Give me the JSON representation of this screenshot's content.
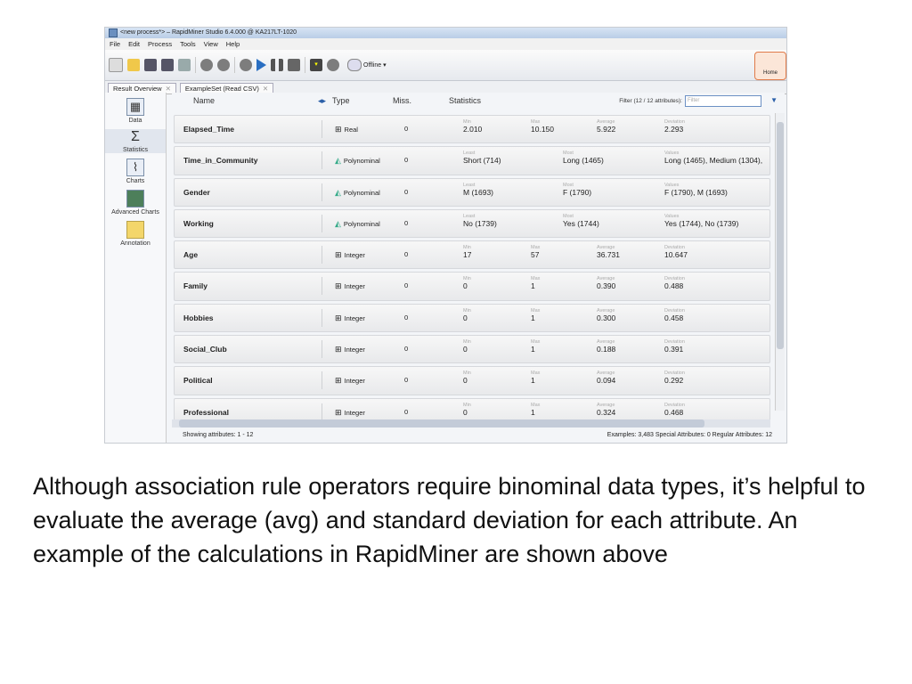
{
  "window": {
    "title": "<new process*> – RapidMiner Studio 6.4.000 @ KA217LT-1020"
  },
  "menu": [
    "File",
    "Edit",
    "Process",
    "Tools",
    "View",
    "Help"
  ],
  "toolbar": {
    "offline_label": "Offline",
    "home_label": "Home"
  },
  "tabs": [
    {
      "label": "Result Overview"
    },
    {
      "label": "ExampleSet (Read CSV)"
    }
  ],
  "left_panel": [
    "Data",
    "Statistics",
    "Charts",
    "Advanced Charts",
    "Annotation"
  ],
  "columns": {
    "name": "Name",
    "type": "Type",
    "miss": "Miss.",
    "statistics": "Statistics"
  },
  "filter": {
    "label": "Filter (12 / 12 attributes):",
    "placeholder": "Filter"
  },
  "rows": [
    {
      "name": "Elapsed_Time",
      "type": "Real",
      "miss": "0",
      "s1_label": "Min",
      "s1": "2.010",
      "s2_label": "Max",
      "s2": "10.150",
      "s3_label": "Average",
      "s3": "5.922",
      "s4_label": "Deviation",
      "s4": "2.293"
    },
    {
      "name": "Time_in_Community",
      "type": "Polynominal",
      "miss": "0",
      "s1_label": "Least",
      "s1": "Short (714)",
      "s2_label": "Most",
      "s2": "Long (1465)",
      "s3_label": "",
      "s3": "",
      "s4_label": "Values",
      "s4": "Long (1465), Medium (1304),"
    },
    {
      "name": "Gender",
      "type": "Polynominal",
      "miss": "0",
      "s1_label": "Least",
      "s1": "M (1693)",
      "s2_label": "Most",
      "s2": "F (1790)",
      "s3_label": "",
      "s3": "",
      "s4_label": "Values",
      "s4": "F (1790), M (1693)"
    },
    {
      "name": "Working",
      "type": "Polynominal",
      "miss": "0",
      "s1_label": "Least",
      "s1": "No (1739)",
      "s2_label": "Most",
      "s2": "Yes (1744)",
      "s3_label": "",
      "s3": "",
      "s4_label": "Values",
      "s4": "Yes (1744), No (1739)"
    },
    {
      "name": "Age",
      "type": "Integer",
      "miss": "0",
      "s1_label": "Min",
      "s1": "17",
      "s2_label": "Max",
      "s2": "57",
      "s3_label": "Average",
      "s3": "36.731",
      "s4_label": "Deviation",
      "s4": "10.647"
    },
    {
      "name": "Family",
      "type": "Integer",
      "miss": "0",
      "s1_label": "Min",
      "s1": "0",
      "s2_label": "Max",
      "s2": "1",
      "s3_label": "Average",
      "s3": "0.390",
      "s4_label": "Deviation",
      "s4": "0.488"
    },
    {
      "name": "Hobbies",
      "type": "Integer",
      "miss": "0",
      "s1_label": "Min",
      "s1": "0",
      "s2_label": "Max",
      "s2": "1",
      "s3_label": "Average",
      "s3": "0.300",
      "s4_label": "Deviation",
      "s4": "0.458"
    },
    {
      "name": "Social_Club",
      "type": "Integer",
      "miss": "0",
      "s1_label": "Min",
      "s1": "0",
      "s2_label": "Max",
      "s2": "1",
      "s3_label": "Average",
      "s3": "0.188",
      "s4_label": "Deviation",
      "s4": "0.391"
    },
    {
      "name": "Political",
      "type": "Integer",
      "miss": "0",
      "s1_label": "Min",
      "s1": "0",
      "s2_label": "Max",
      "s2": "1",
      "s3_label": "Average",
      "s3": "0.094",
      "s4_label": "Deviation",
      "s4": "0.292"
    },
    {
      "name": "Professional",
      "type": "Integer",
      "miss": "0",
      "s1_label": "Min",
      "s1": "0",
      "s2_label": "Max",
      "s2": "1",
      "s3_label": "Average",
      "s3": "0.324",
      "s4_label": "Deviation",
      "s4": "0.468"
    }
  ],
  "status": {
    "left": "Showing attributes: 1 - 12",
    "right": "Examples: 3,483   Special Attributes: 0   Regular Attributes: 12"
  },
  "caption": "Although association rule operators require binominal data types, it’s helpful to evaluate the average (avg) and standard deviation for each attribute. An example of the calculations in RapidMiner are shown above"
}
